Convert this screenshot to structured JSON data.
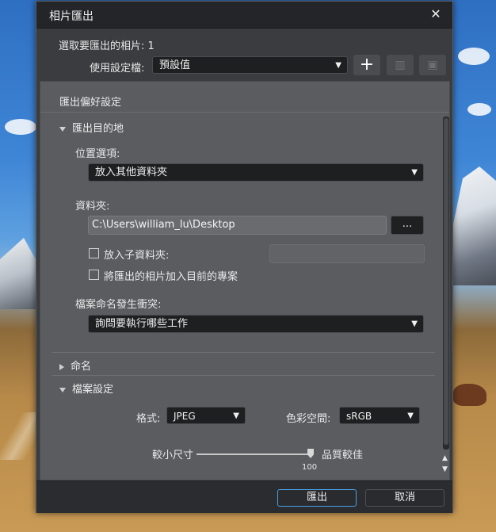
{
  "dialog": {
    "title": "相片匯出",
    "close_label": "✕"
  },
  "selection": {
    "label": "選取要匯出的相片: 1"
  },
  "preset": {
    "label": "使用設定檔:",
    "value": "預設值",
    "add": "+",
    "delete": "🗑",
    "save": "💾"
  },
  "prefs": {
    "header": "匯出偏好設定"
  },
  "destination": {
    "title": "匯出目的地",
    "location_label": "位置選項:",
    "location_value": "放入其他資料夾",
    "folder_label": "資料夾:",
    "folder_value": "C:\\Users\\william_lu\\Desktop",
    "browse_label": "...",
    "subfolder_label": "放入子資料夾:",
    "subfolder_value": "",
    "add_to_project_label": "將匯出的相片加入目前的專案",
    "conflict_label": "檔案命名發生衝突:",
    "conflict_value": "詢問要執行哪些工作"
  },
  "naming": {
    "title": "命名"
  },
  "file_settings": {
    "title": "檔案設定",
    "format_label": "格式:",
    "format_value": "JPEG",
    "colorspace_label": "色彩空間:",
    "colorspace_value": "sRGB",
    "size_small": "較小尺寸",
    "quality_high": "品質較佳",
    "quality_value": "100",
    "quality_fraction": 1.0
  },
  "footer": {
    "export_label": "匯出",
    "cancel_label": "取消"
  },
  "scroll": {
    "up": "▲",
    "down": "▼"
  }
}
